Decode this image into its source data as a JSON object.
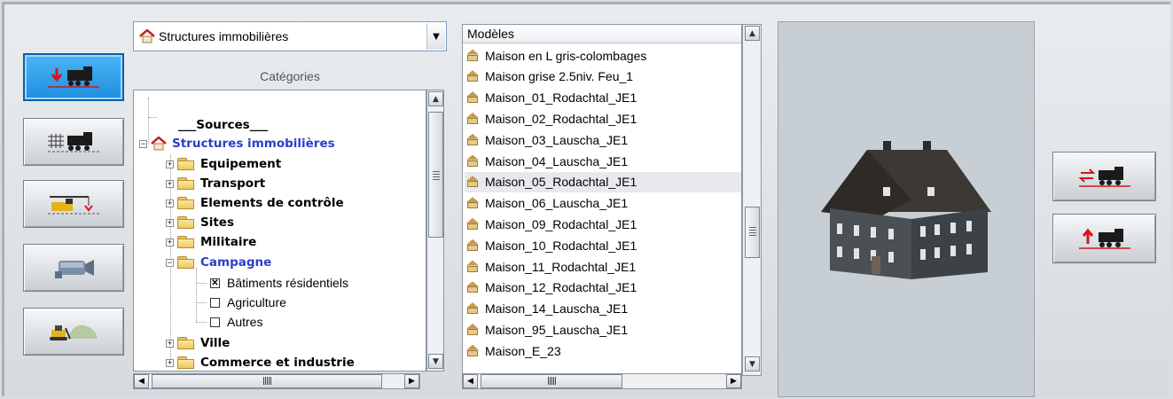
{
  "toolbar_left": [
    {
      "name": "place-train-button",
      "icon": "train-down-arrow-icon",
      "active": true
    },
    {
      "name": "track-train-button",
      "icon": "train-tracks-icon",
      "active": false
    },
    {
      "name": "crane-button",
      "icon": "crane-icon",
      "active": false
    },
    {
      "name": "camera-button",
      "icon": "video-camera-icon",
      "active": false
    },
    {
      "name": "terrain-button",
      "icon": "bulldozer-icon",
      "active": false
    }
  ],
  "category_select": {
    "value": "Structures immobilières",
    "icon": "house-icon"
  },
  "categories_label": "Catégories",
  "tree": {
    "sources": "___Sources___",
    "root": "Structures immobilières",
    "folders": [
      "Equipement",
      "Transport",
      "Elements de contrôle",
      "Sites",
      "Militaire"
    ],
    "campagne": "Campagne",
    "campagne_children": [
      {
        "label": "Bâtiments résidentiels",
        "checked": true
      },
      {
        "label": "Agriculture",
        "checked": false
      },
      {
        "label": "Autres",
        "checked": false
      }
    ],
    "folders_after": [
      "Ville",
      "Commerce et industrie"
    ]
  },
  "models": {
    "header": "Modèles",
    "items": [
      "Maison en L gris-colombages",
      "Maison grise 2.5niv. Feu_1",
      "Maison_01_Rodachtal_JE1",
      "Maison_02_Rodachtal_JE1",
      "Maison_03_Lauscha_JE1",
      "Maison_04_Lauscha_JE1",
      "Maison_05_Rodachtal_JE1",
      "Maison_06_Lauscha_JE1",
      "Maison_09_Rodachtal_JE1",
      "Maison_10_Rodachtal_JE1",
      "Maison_11_Rodachtal_JE1",
      "Maison_12_Rodachtal_JE1",
      "Maison_14_Lauscha_JE1",
      "Maison_95_Lauscha_JE1",
      "Maison_E_23"
    ],
    "selected": "Maison_05_Rodachtal_JE1"
  },
  "preview": {
    "subject": "house-preview-image"
  },
  "toolbar_right": [
    {
      "name": "swap-train-button",
      "icon": "train-swap-icon"
    },
    {
      "name": "lift-train-button",
      "icon": "train-up-arrow-icon"
    }
  ],
  "colors": {
    "active_button": "#1d8fe0",
    "tree_highlight": "#2a3fc7",
    "selection": "#e7e9ec"
  }
}
